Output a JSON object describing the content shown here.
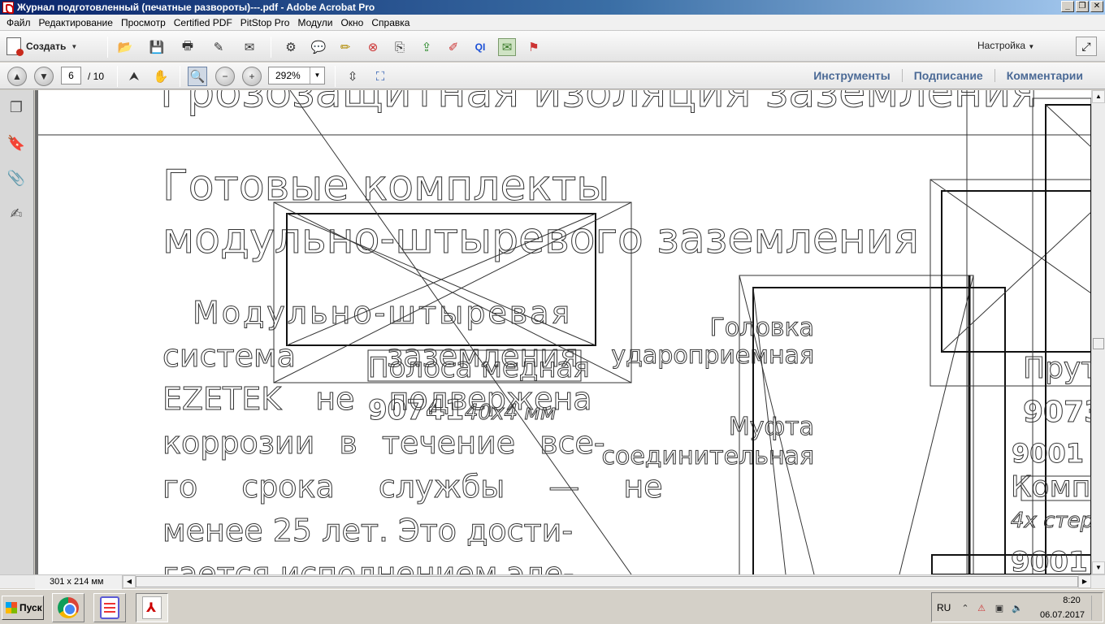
{
  "window": {
    "title": "Журнал подготовленный (печатные развороты)---.pdf - Adobe Acrobat Pro",
    "min_btn": "_",
    "max_btn": "❐",
    "close_btn": "✕"
  },
  "menu": [
    "Файл",
    "Редактирование",
    "Просмотр",
    "Certified PDF",
    "PitStop Pro",
    "Модули",
    "Окно",
    "Справка"
  ],
  "toolbar": {
    "create_label": "Создать",
    "settings_label": "Настройка"
  },
  "nav": {
    "current_page": "6",
    "total_pages": "/ 10",
    "zoom": "292%"
  },
  "panes": [
    "Инструменты",
    "Подписание",
    "Комментарии"
  ],
  "document": {
    "header_fragment": "Грозозащитная изоляция заземления",
    "heading_line1": "Готовые комплекты",
    "heading_line2": "модульно-штыревого заземления",
    "body_lines": [
      "Модульно-штыревая",
      "система заземления",
      "EZETEK не подвержена",
      "коррозии в течение все-",
      "го срока службы — не",
      "менее 25 лет. Это дости-",
      "гается исполнением эле-"
    ],
    "label_strip": "Полоса медная",
    "label_strip_code": "90741",
    "label_strip_size": "40x4 мм",
    "label_head_1": "Головка",
    "label_head_2": "ударопpиемная",
    "label_coupling_1": "Муфта",
    "label_coupling_2": "соединительная",
    "label_rod": "Прут",
    "code_9073": "9073",
    "code_9001a": "9001",
    "label_kit": "Компл",
    "label_kit_sub": "4x стер",
    "code_9001b": "9001"
  },
  "status": {
    "page_size": "301 x 214 мм"
  },
  "taskbar": {
    "start_label": "Пуск",
    "lang": "RU",
    "time": "8:20",
    "date": "06.07.2017"
  }
}
